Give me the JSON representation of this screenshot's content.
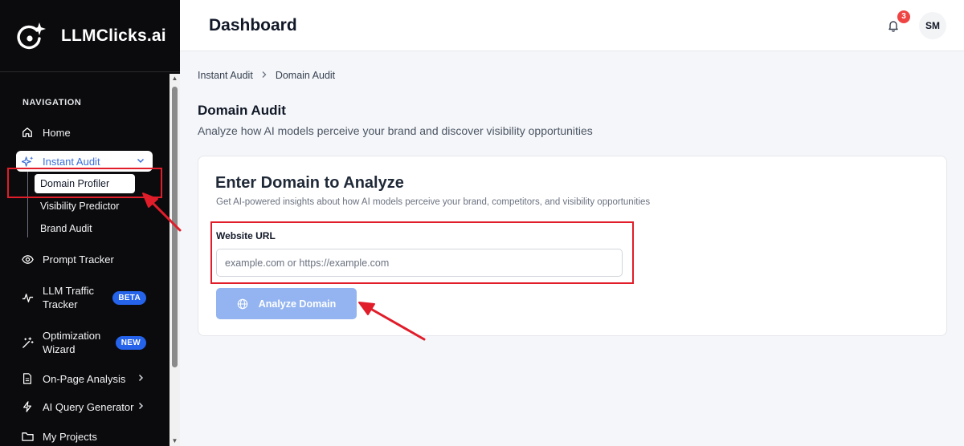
{
  "brand": {
    "name": "LLMClicks.ai"
  },
  "header": {
    "title": "Dashboard",
    "notification_count": "3",
    "avatar_initials": "SM"
  },
  "sidebar": {
    "heading": "NAVIGATION",
    "items": {
      "home": "Home",
      "instant_audit": "Instant Audit",
      "prompt_tracker": "Prompt Tracker",
      "llm_traffic_tracker": "LLM Traffic Tracker",
      "llm_traffic_line1": "LLM Traffic",
      "llm_traffic_line2": "Tracker",
      "llm_traffic_badge": "BETA",
      "optimization_line1": "Optimization",
      "optimization_line2": "Wizard",
      "optimization_badge": "NEW",
      "on_page_analysis": "On-Page Analysis",
      "ai_query_generator": "AI Query Generator",
      "my_projects": "My Projects"
    },
    "sub_items": {
      "domain_profiler": "Domain Profiler",
      "visibility_predictor": "Visibility Predictor",
      "brand_audit": "Brand Audit"
    }
  },
  "breadcrumb": {
    "parent": "Instant Audit",
    "current": "Domain Audit"
  },
  "page": {
    "title": "Domain Audit",
    "subtitle": "Analyze how AI models perceive your brand and discover visibility opportunities"
  },
  "card": {
    "title": "Enter Domain to Analyze",
    "subtitle": "Get AI-powered insights about how AI models perceive your brand, competitors, and visibility opportunities",
    "field_label": "Website URL",
    "input_value": "",
    "input_placeholder": "example.com or https://example.com",
    "button_label": "Analyze Domain"
  },
  "colors": {
    "sidebar_bg": "#0b0b0d",
    "accent": "#3b6fd8",
    "badge": "#2563eb",
    "notification": "#ef4444",
    "button_disabled": "#93b4f0",
    "annotation": "#e11d2a"
  }
}
